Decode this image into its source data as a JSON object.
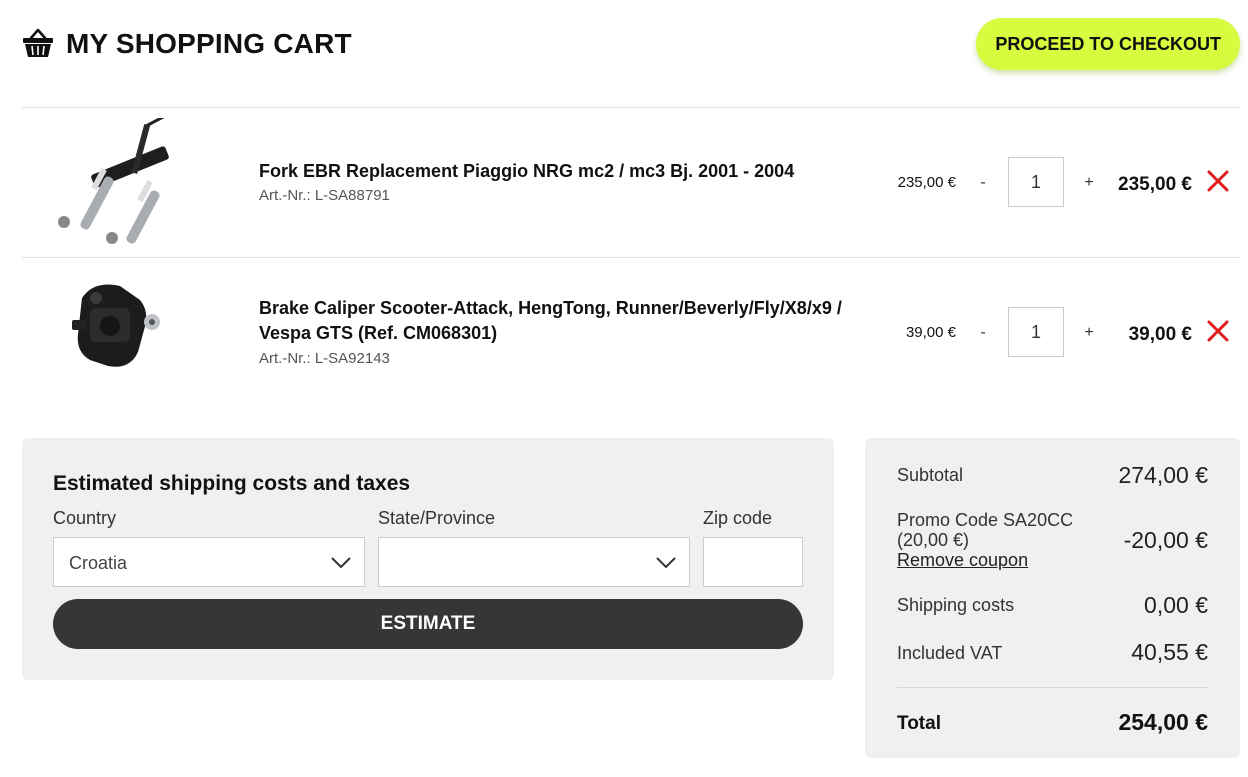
{
  "header": {
    "title": "MY SHOPPING CART",
    "checkout_label": "PROCEED TO CHECKOUT",
    "accent_color": "#d8fb3f"
  },
  "items": [
    {
      "name": "Fork EBR Replacement Piaggio NRG mc2 / mc3 Bj. 2001 - 2004",
      "article": "Art.-Nr.: L-SA88791",
      "unit_price": "235,00 €",
      "minus": "-",
      "quantity": "1",
      "plus": "+",
      "total": "235,00 €",
      "image_icon": "fork-image"
    },
    {
      "name": "Brake Caliper Scooter-Attack, HengTong, Runner/Beverly/Fly/X8/x9 / Vespa GTS (Ref. CM068301)",
      "article": "Art.-Nr.: L-SA92143",
      "unit_price": "39,00 €",
      "minus": "-",
      "quantity": "1",
      "plus": "+",
      "total": "39,00 €",
      "image_icon": "brake-caliper-image"
    }
  ],
  "remove_color": "#e11b1b",
  "shipping": {
    "title": "Estimated shipping costs and taxes",
    "country_label": "Country",
    "country_value": "Croatia",
    "state_label": "State/Province",
    "state_value": "",
    "zip_label": "Zip code",
    "zip_value": "",
    "estimate_label": "ESTIMATE"
  },
  "summary": {
    "subtotal_label": "Subtotal",
    "subtotal_value": "274,00 €",
    "promo_label": "Promo Code SA20CC (20,00 €)",
    "promo_value": "-20,00 €",
    "remove_coupon": "Remove coupon",
    "shipping_label": "Shipping costs",
    "shipping_value": "0,00 €",
    "vat_label": "Included VAT",
    "vat_value": "40,55 €",
    "total_label": "Total",
    "total_value": "254,00 €"
  }
}
